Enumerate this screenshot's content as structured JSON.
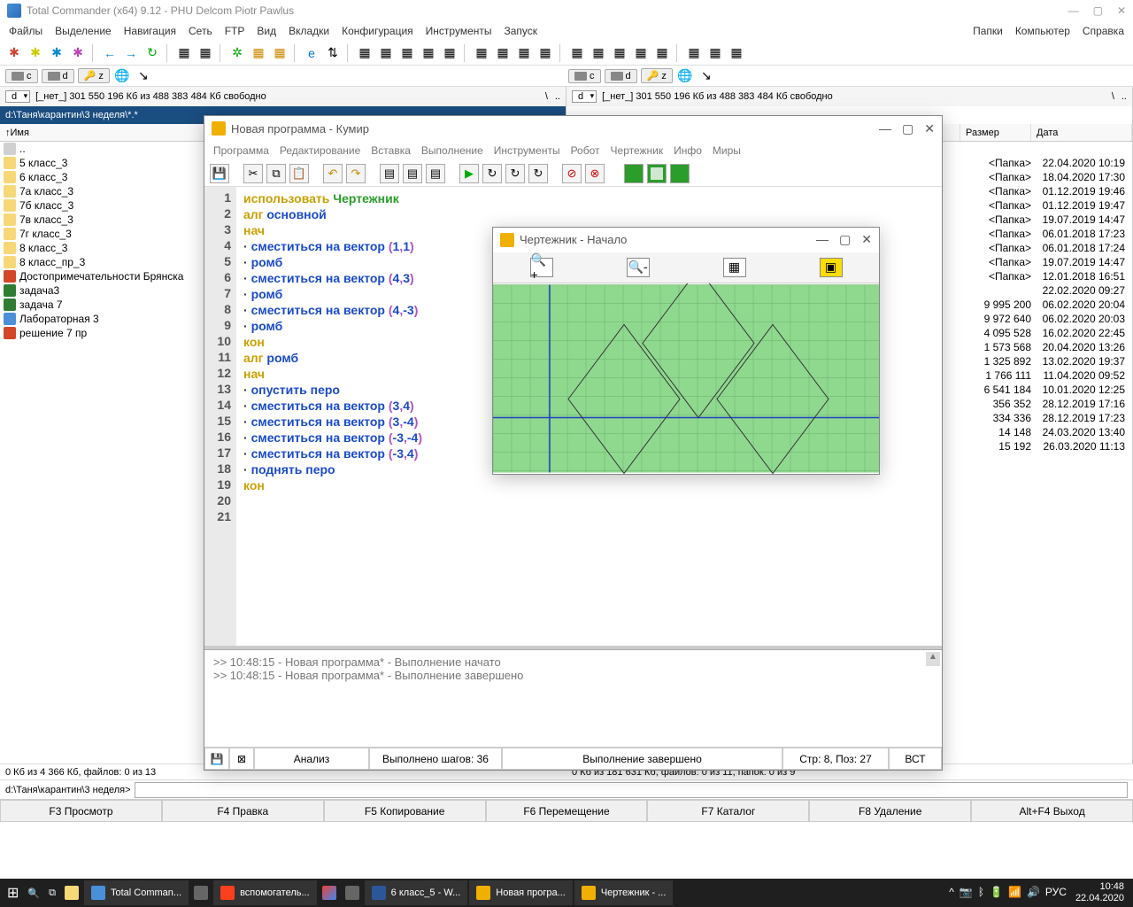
{
  "tc": {
    "title": "Total Commander (x64) 9.12 - PHU Delcom Piotr Pawlus",
    "menu": [
      "Файлы",
      "Выделение",
      "Навигация",
      "Сеть",
      "FTP",
      "Вид",
      "Вкладки",
      "Конфигурация",
      "Инструменты",
      "Запуск"
    ],
    "menu_right": [
      "Папки",
      "Компьютер",
      "Справка"
    ],
    "drive_d": "d",
    "drive_c": "c",
    "drive_z": "z",
    "free": "[_нет_]  301 550 196 Кб из 488 383 484 Кб свободно",
    "path_left": "d:\\Таня\\карантин\\3 неделя\\*.*",
    "col_name": "Имя",
    "col_size": "Размер",
    "col_date": "Дата",
    "files": [
      {
        "name": "..",
        "size": "",
        "date": ""
      },
      {
        "name": "5 класс_3",
        "size": "<Папка>",
        "date": "22.04.2020 10:19",
        "ic": "folder"
      },
      {
        "name": "6 класс_3",
        "size": "<Папка>",
        "date": "18.04.2020 17:30",
        "ic": "folder"
      },
      {
        "name": "7а класс_3",
        "size": "<Папка>",
        "date": "01.12.2019 19:46",
        "ic": "folder"
      },
      {
        "name": "7б класс_3",
        "size": "<Папка>",
        "date": "01.12.2019 19:47",
        "ic": "folder"
      },
      {
        "name": "7в класс_3",
        "size": "<Папка>",
        "date": "19.07.2019 14:47",
        "ic": "folder"
      },
      {
        "name": "7г класс_3",
        "size": "<Папка>",
        "date": "06.01.2018 17:23",
        "ic": "folder"
      },
      {
        "name": "8 класс_3",
        "size": "<Папка>",
        "date": "06.01.2018 17:24",
        "ic": "folder"
      },
      {
        "name": "8 класс_пр_3",
        "size": "<Папка>",
        "date": "19.07.2019 14:47",
        "ic": "folder"
      },
      {
        "name": "Достопримечательности Брянска",
        "size": "<Папка>",
        "date": "12.01.2018 16:51",
        "ic": "pp"
      },
      {
        "name": "задача3",
        "size": "",
        "date": "22.02.2020 09:27",
        "ic": "xl"
      },
      {
        "name": "задача 7",
        "size": "9 995 200",
        "date": "06.02.2020 20:04",
        "ic": "xl"
      },
      {
        "name": "Лабораторная 3",
        "size": "9 972 640",
        "date": "06.02.2020 20:03",
        "ic": "doc"
      },
      {
        "name": "решение 7 пр",
        "size": "4 095 528",
        "date": "16.02.2020 22:45",
        "ic": "pp"
      }
    ],
    "extra_rows": [
      {
        "size": "1 573 568",
        "date": "20.04.2020 13:26"
      },
      {
        "size": "1 325 892",
        "date": "13.02.2020 19:37"
      },
      {
        "size": "1 766 111",
        "date": "11.04.2020 09:52"
      },
      {
        "size": "6 541 184",
        "date": "10.01.2020 12:25"
      },
      {
        "size": "356 352",
        "date": "28.12.2019 17:16"
      },
      {
        "size": "334 336",
        "date": "28.12.2019 17:23"
      },
      {
        "size": "14 148",
        "date": "24.03.2020 13:40"
      },
      {
        "size": "15 192",
        "date": "26.03.2020 11:13"
      }
    ],
    "status_left": "0 Кб из 4 366 Кб, файлов: 0 из 13",
    "status_right": "0 Кб из 181 631 Кб, файлов: 0 из 11, папок: 0 из 9",
    "cmd_prompt": "d:\\Таня\\карантин\\3 неделя>",
    "fkeys": [
      "F3 Просмотр",
      "F4 Правка",
      "F5 Копирование",
      "F6 Перемещение",
      "F7 Каталог",
      "F8 Удаление",
      "Alt+F4 Выход"
    ]
  },
  "kumir": {
    "title": "Новая программа - Кумир",
    "menu": [
      "Программа",
      "Редактирование",
      "Вставка",
      "Выполнение",
      "Инструменты",
      "Робот",
      "Чертежник",
      "Инфо",
      "Миры"
    ],
    "code": [
      {
        "t": [
          {
            "c": "kw",
            "s": "использовать "
          },
          {
            "c": "fn",
            "s": "Чертежник"
          }
        ]
      },
      {
        "t": [
          {
            "c": "kw",
            "s": "алг "
          },
          {
            "c": "id",
            "s": "основной"
          }
        ]
      },
      {
        "t": [
          {
            "c": "kw",
            "s": "нач"
          }
        ]
      },
      {
        "t": [
          {
            "c": "dot",
            "s": "· "
          },
          {
            "c": "id",
            "s": "сместиться на вектор "
          },
          {
            "c": "par",
            "s": "("
          },
          {
            "c": "num",
            "s": "1"
          },
          {
            "c": "par",
            "s": ","
          },
          {
            "c": "num",
            "s": "1"
          },
          {
            "c": "par",
            "s": ")"
          }
        ]
      },
      {
        "t": [
          {
            "c": "dot",
            "s": "· "
          },
          {
            "c": "id",
            "s": "ромб"
          }
        ]
      },
      {
        "t": [
          {
            "c": "dot",
            "s": "· "
          },
          {
            "c": "id",
            "s": "сместиться на вектор "
          },
          {
            "c": "par",
            "s": "("
          },
          {
            "c": "num",
            "s": "4"
          },
          {
            "c": "par",
            "s": ","
          },
          {
            "c": "num",
            "s": "3"
          },
          {
            "c": "par",
            "s": ")"
          }
        ]
      },
      {
        "t": [
          {
            "c": "dot",
            "s": "· "
          },
          {
            "c": "id",
            "s": "ромб"
          }
        ]
      },
      {
        "t": [
          {
            "c": "dot",
            "s": "· "
          },
          {
            "c": "id",
            "s": "сместиться на вектор "
          },
          {
            "c": "par",
            "s": "("
          },
          {
            "c": "num",
            "s": "4"
          },
          {
            "c": "par",
            "s": ","
          },
          {
            "c": "num",
            "s": "-3"
          },
          {
            "c": "par",
            "s": ")"
          }
        ]
      },
      {
        "t": [
          {
            "c": "dot",
            "s": "· "
          },
          {
            "c": "id",
            "s": "ромб"
          }
        ]
      },
      {
        "t": [
          {
            "c": "kw",
            "s": "кон"
          }
        ]
      },
      {
        "t": [
          {
            "c": "",
            "s": ""
          }
        ]
      },
      {
        "t": [
          {
            "c": "kw",
            "s": "алг "
          },
          {
            "c": "id",
            "s": "ромб"
          }
        ]
      },
      {
        "t": [
          {
            "c": "kw",
            "s": "нач"
          }
        ]
      },
      {
        "t": [
          {
            "c": "dot",
            "s": "· "
          },
          {
            "c": "id",
            "s": "опустить перо"
          }
        ]
      },
      {
        "t": [
          {
            "c": "dot",
            "s": "· "
          },
          {
            "c": "id",
            "s": "сместиться на вектор "
          },
          {
            "c": "par",
            "s": "("
          },
          {
            "c": "num",
            "s": "3"
          },
          {
            "c": "par",
            "s": ","
          },
          {
            "c": "num",
            "s": "4"
          },
          {
            "c": "par",
            "s": ")"
          }
        ]
      },
      {
        "t": [
          {
            "c": "dot",
            "s": "· "
          },
          {
            "c": "id",
            "s": "сместиться на вектор "
          },
          {
            "c": "par",
            "s": "("
          },
          {
            "c": "num",
            "s": "3"
          },
          {
            "c": "par",
            "s": ","
          },
          {
            "c": "num",
            "s": "-4"
          },
          {
            "c": "par",
            "s": ")"
          }
        ]
      },
      {
        "t": [
          {
            "c": "dot",
            "s": "· "
          },
          {
            "c": "id",
            "s": "сместиться на вектор "
          },
          {
            "c": "par",
            "s": "("
          },
          {
            "c": "num",
            "s": "-3"
          },
          {
            "c": "par",
            "s": ","
          },
          {
            "c": "num",
            "s": "-4"
          },
          {
            "c": "par",
            "s": ")"
          }
        ]
      },
      {
        "t": [
          {
            "c": "dot",
            "s": "· "
          },
          {
            "c": "id",
            "s": "сместиться на вектор "
          },
          {
            "c": "par",
            "s": "("
          },
          {
            "c": "num",
            "s": "-3"
          },
          {
            "c": "par",
            "s": ","
          },
          {
            "c": "num",
            "s": "4"
          },
          {
            "c": "par",
            "s": ")"
          }
        ]
      },
      {
        "t": [
          {
            "c": "dot",
            "s": "· "
          },
          {
            "c": "id",
            "s": "поднять перо"
          }
        ]
      },
      {
        "t": [
          {
            "c": "kw",
            "s": "кон"
          }
        ]
      },
      {
        "t": [
          {
            "c": "",
            "s": ""
          }
        ]
      }
    ],
    "log": [
      ">> 10:48:15 - Новая программа* - Выполнение начато",
      ">> 10:48:15 - Новая программа* - Выполнение завершено"
    ],
    "status": {
      "a": "Анализ",
      "b": "Выполнено шагов: 36",
      "c": "Выполнение завершено",
      "d": "Стр: 8, Поз: 27",
      "e": "ВСТ"
    }
  },
  "drawer": {
    "title": "Чертежник - Начало"
  },
  "taskbar": {
    "items": [
      "Total Comman...",
      "вспомогатель...",
      "",
      "6 класс_5 - W...",
      "Новая програ...",
      "Чертежник - ..."
    ],
    "lang": "РУС",
    "time": "10:48",
    "date": "22.04.2020"
  }
}
